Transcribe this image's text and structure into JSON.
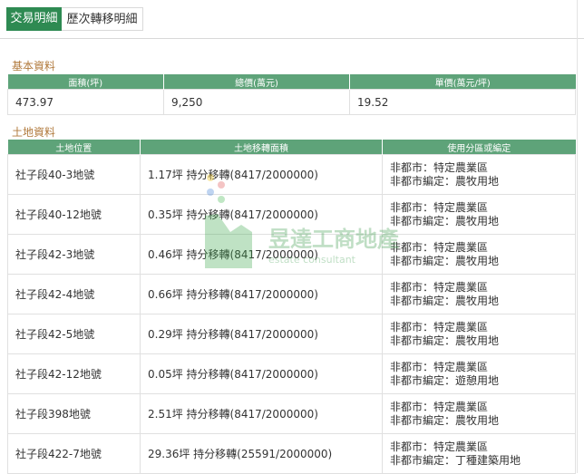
{
  "tabs": [
    {
      "label": "交易明細",
      "active": true
    },
    {
      "label": "歷次轉移明細",
      "active": false
    }
  ],
  "basic": {
    "title": "基本資料",
    "headers": [
      "面積(坪)",
      "總價(萬元)",
      "單價(萬元/坪)"
    ],
    "values": [
      "473.97",
      "9,250",
      "19.52"
    ]
  },
  "land": {
    "title": "土地資料",
    "headers": [
      "土地位置",
      "土地移轉面積",
      "使用分區或編定"
    ],
    "rows": [
      {
        "location": "社子段40-3地號",
        "area": "1.17坪 持分移轉(8417/2000000)",
        "zone1": "非都市：特定農業區",
        "zone2": "非都市編定：農牧用地"
      },
      {
        "location": "社子段40-12地號",
        "area": "0.35坪 持分移轉(8417/2000000)",
        "zone1": "非都市：特定農業區",
        "zone2": "非都市編定：農牧用地"
      },
      {
        "location": "社子段42-3地號",
        "area": "0.46坪 持分移轉(8417/2000000)",
        "zone1": "非都市：特定農業區",
        "zone2": "非都市編定：農牧用地"
      },
      {
        "location": "社子段42-4地號",
        "area": "0.66坪 持分移轉(8417/2000000)",
        "zone1": "非都市：特定農業區",
        "zone2": "非都市編定：農牧用地"
      },
      {
        "location": "社子段42-5地號",
        "area": "0.29坪 持分移轉(8417/2000000)",
        "zone1": "非都市：特定農業區",
        "zone2": "非都市編定：農牧用地"
      },
      {
        "location": "社子段42-12地號",
        "area": "0.05坪 持分移轉(8417/2000000)",
        "zone1": "非都市：特定農業區",
        "zone2": "非都市編定：遊憩用地"
      },
      {
        "location": "社子段398地號",
        "area": "2.51坪 持分移轉(8417/2000000)",
        "zone1": "非都市：特定農業區",
        "zone2": "非都市編定：農牧用地"
      },
      {
        "location": "社子段422-7地號",
        "area": "29.36坪 持分移轉(25591/2000000)",
        "zone1": "非都市：特定農業區",
        "zone2": "非都市編定：丁種建築用地"
      }
    ]
  },
  "watermark": {
    "name": "昱達工商地產",
    "tagline": "estate consultant"
  }
}
